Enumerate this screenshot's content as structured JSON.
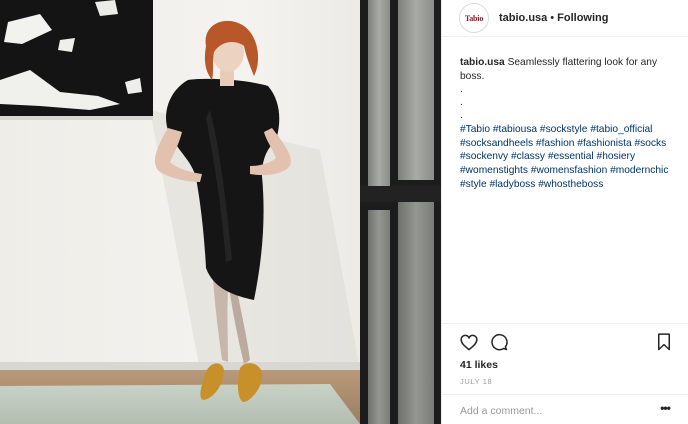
{
  "post": {
    "image_alt": "Woman in a black dress wearing gold flats, leaning against a white wall"
  },
  "header": {
    "avatar_text": "Tabio",
    "username": "tabio.usa",
    "separator": "•",
    "follow_status": "Following"
  },
  "caption": {
    "username": "tabio.usa",
    "text": " Seamlessly flattering look for any boss.",
    "dots": [
      ".",
      ".",
      "."
    ],
    "hashtags": [
      "#Tabio",
      "#tabiousa",
      "#sockstyle",
      "#tabio_official",
      "#socksandheels",
      "#fashion",
      "#fashionista",
      "#socks",
      "#sockenvy",
      "#classy",
      "#essential",
      "#hosiery",
      "#womenstights",
      "#womensfashion",
      "#modernchic",
      "#style",
      "#ladyboss",
      "#whostheboss"
    ]
  },
  "actions": {
    "icons": [
      "heart-icon",
      "comment-icon",
      "bookmark-icon"
    ],
    "likes": "41 likes",
    "date": "JULY 18"
  },
  "comment": {
    "placeholder": "Add a comment...",
    "more_label": "•••"
  },
  "colors": {
    "hashtag": "#003569",
    "text": "#262626",
    "muted": "#999999",
    "divider": "#efefef"
  }
}
